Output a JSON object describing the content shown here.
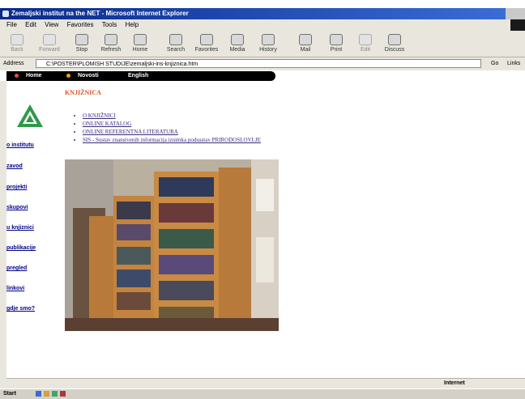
{
  "window": {
    "title": "Zemaljski institut na the NET - Microsoft Internet Explorer"
  },
  "menu": {
    "items": [
      "File",
      "Edit",
      "View",
      "Favorites",
      "Tools",
      "Help"
    ]
  },
  "toolbar": {
    "buttons": [
      "Back",
      "Forward",
      "Stop",
      "Refresh",
      "Home",
      "Search",
      "Favorites",
      "Media",
      "History",
      "Mail",
      "Print",
      "Edit",
      "Discuss"
    ]
  },
  "address": {
    "label": "Address",
    "value": "C:\\POSTER\\PLOMISH STUDIJE\\zemaljski-ins-knjiznica.htm",
    "go": "Go",
    "links": "Links"
  },
  "topnav": {
    "items": [
      "Home",
      "Novosti",
      "English"
    ]
  },
  "sidebar": {
    "items": [
      "o institutu",
      "zavod",
      "projekti",
      "skupovi",
      "u knjiznici",
      "publikacije",
      "pregled",
      "linkovi",
      "gdje smo?"
    ]
  },
  "main": {
    "heading": "KNJIŽNICA",
    "list": [
      "O KNJIŽNICI",
      "ONLINE KATALOG",
      "ONLINE REFERENTNA LITERATURA",
      "SIS - Sustav znanstvenih informacija iznimka podsustav PRIRODOSLOVLJE"
    ],
    "photo_alt": "library bookshelves"
  },
  "status": {
    "zone": "Internet"
  },
  "taskbar": {
    "start": "Start"
  },
  "colors": {
    "title_gradient_start": "#0a2a8a",
    "title_gradient_end": "#3b6fd8",
    "heading": "#d9552a",
    "links": "#3b2a7a",
    "sidebar_links": "#00008b"
  }
}
